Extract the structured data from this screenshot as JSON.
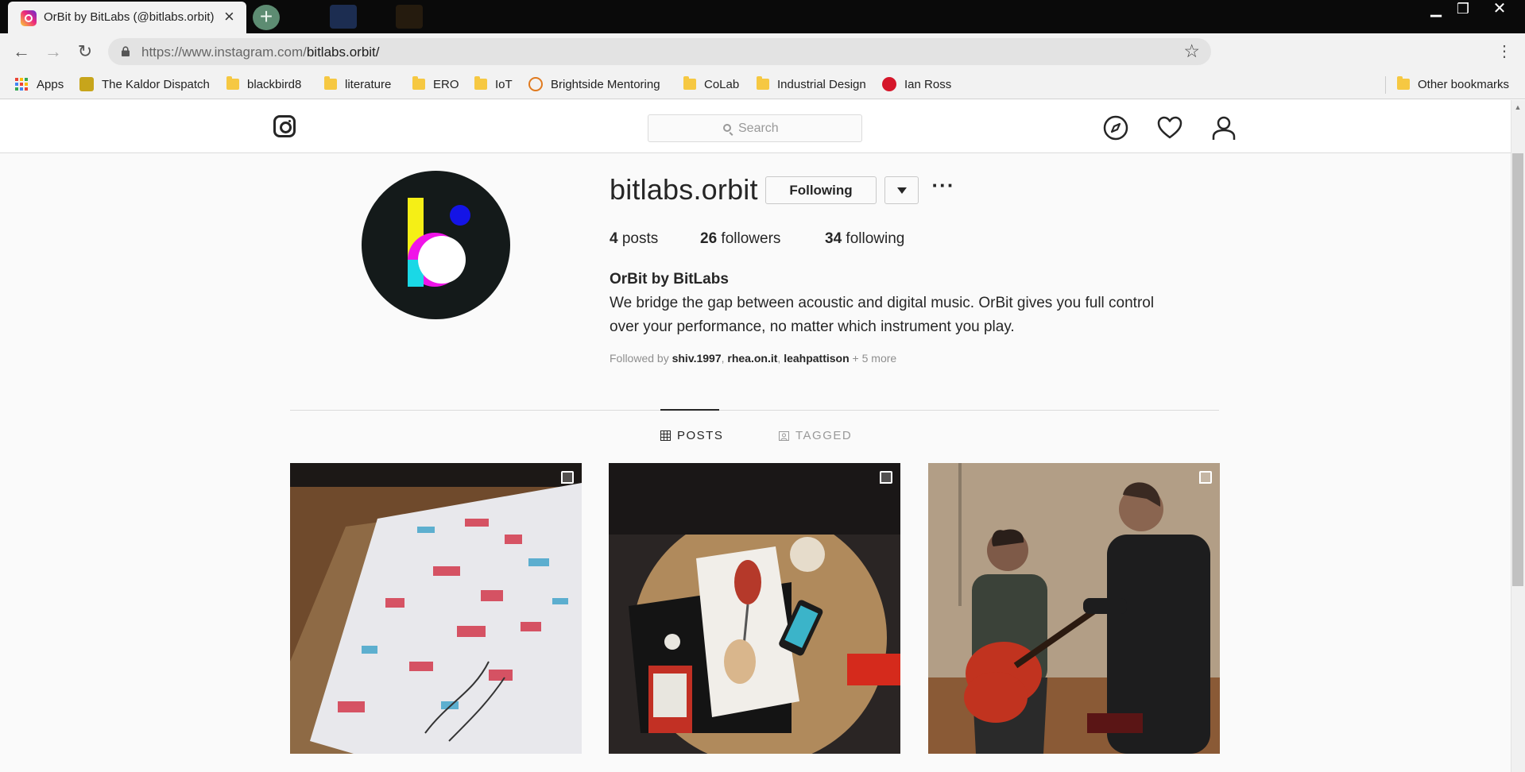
{
  "browser": {
    "tab_title": "OrBit by BitLabs (@bitlabs.orbit) •",
    "url_host": "https://www.instagram.com/",
    "url_path": "bitlabs.orbit/",
    "bookmarks": [
      {
        "label": "Apps",
        "icon": "apps-grid-icon"
      },
      {
        "label": "The Kaldor Dispatch",
        "icon": "kaldor-icon"
      },
      {
        "label": "blackbird8",
        "icon": "folder-icon"
      },
      {
        "label": "literature",
        "icon": "folder-icon"
      },
      {
        "label": "ERO",
        "icon": "folder-icon"
      },
      {
        "label": "IoT",
        "icon": "folder-icon"
      },
      {
        "label": "Brightside Mentoring",
        "icon": "brightside-icon"
      },
      {
        "label": "CoLab",
        "icon": "folder-icon"
      },
      {
        "label": "Industrial Design",
        "icon": "folder-icon"
      },
      {
        "label": "Ian Ross",
        "icon": "pinterest-icon"
      }
    ],
    "other_bookmarks": "Other bookmarks"
  },
  "header": {
    "search_placeholder": "Search"
  },
  "profile": {
    "username": "bitlabs.orbit",
    "following_button": "Following",
    "more": "···",
    "posts_count": "4",
    "posts_label": "posts",
    "followers_count": "26",
    "followers_label": "followers",
    "following_count": "34",
    "following_label": "following",
    "full_name": "OrBit by BitLabs",
    "bio_line1": "We bridge the gap between acoustic and digital music. OrBit gives you full control",
    "bio_line2": "over your performance, no matter which instrument you play.",
    "followed_by_prefix": "Followed by",
    "followed_by_users": [
      "shiv.1997",
      "rhea.on.it",
      "leahpattison"
    ],
    "followed_by_more": "+ 5 more"
  },
  "tabs": {
    "posts": "POSTS",
    "tagged": "TAGGED"
  },
  "colors": {
    "brand_yellow": "#f5ef16",
    "brand_magenta": "#f014e8",
    "brand_cyan": "#1ad8e6",
    "brand_blue": "#1414e6"
  }
}
